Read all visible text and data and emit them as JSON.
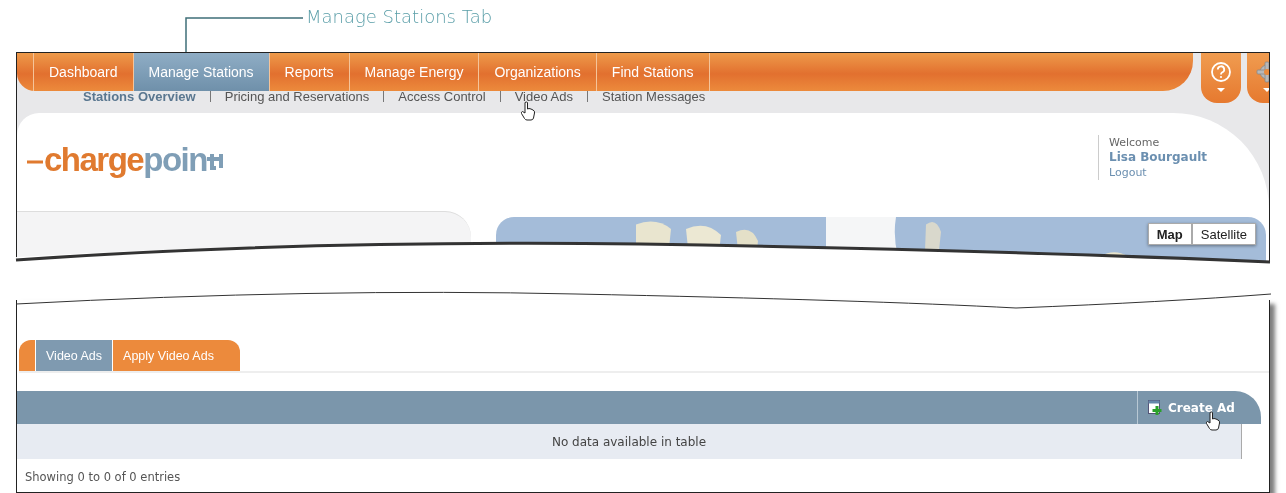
{
  "annotation": {
    "label": "Manage Stations Tab"
  },
  "nav": {
    "tabs": [
      {
        "label": "Dashboard",
        "selected": false
      },
      {
        "label": "Manage Stations",
        "selected": true
      },
      {
        "label": "Reports",
        "selected": false
      },
      {
        "label": "Manage Energy",
        "selected": false
      },
      {
        "label": "Organizations",
        "selected": false
      },
      {
        "label": "Find Stations",
        "selected": false
      }
    ]
  },
  "subnav": [
    {
      "label": "Stations Overview",
      "selected": true
    },
    {
      "label": "Pricing and Reservations",
      "selected": false
    },
    {
      "label": "Access Control",
      "selected": false
    },
    {
      "label": "Video Ads",
      "selected": false
    },
    {
      "label": "Station Messages",
      "selected": false
    }
  ],
  "logo": {
    "part_1": "charge",
    "part_2": "poin"
  },
  "user": {
    "greeting": "Welcome",
    "name": "Lisa Bourgault",
    "logout": "Logout"
  },
  "map": {
    "kind": "picture",
    "types": [
      {
        "label": "Map",
        "selected": true
      },
      {
        "label": "Satellite",
        "selected": false
      }
    ]
  },
  "content_tabs": [
    {
      "label": "Video Ads",
      "selected": true
    },
    {
      "label": "Apply Video Ads",
      "selected": false
    }
  ],
  "table": {
    "action": "Create Ad",
    "empty_message": "No data available in table",
    "info": "Showing 0 to 0 of 0 entries"
  }
}
